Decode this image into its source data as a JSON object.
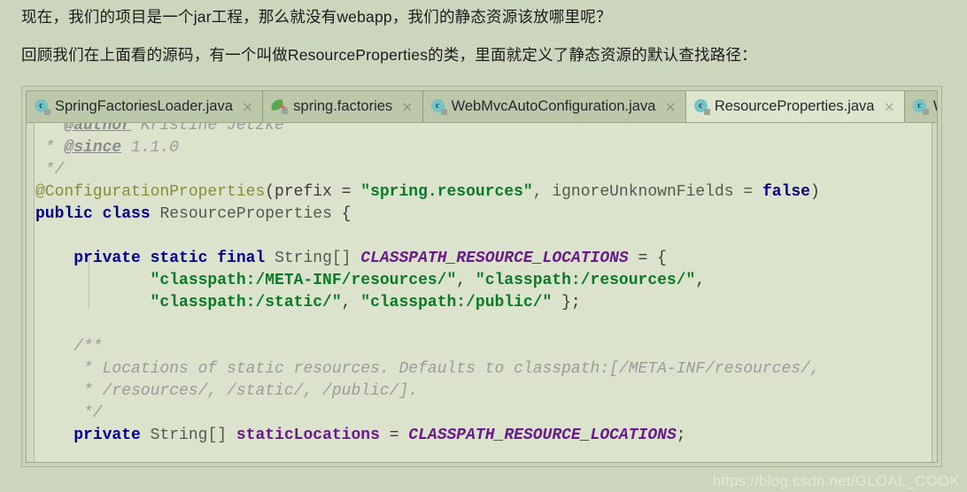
{
  "prose": {
    "paragraph_1": "现在，我们的项目是一个jar工程，那么就没有webapp，我们的静态资源该放哪里呢？",
    "paragraph_2": "回顾我们在上面看的源码，有一个叫做ResourceProperties的类，里面就定义了静态资源的默认查找路径："
  },
  "editor": {
    "tabs": [
      {
        "label": "SpringFactoriesLoader.java",
        "icon": "java-class-icon",
        "close": "×",
        "active": false
      },
      {
        "label": "spring.factories",
        "icon": "spring-leaf-icon",
        "close": "×",
        "active": false
      },
      {
        "label": "WebMvcAutoConfiguration.java",
        "icon": "java-class-icon",
        "close": "×",
        "active": false
      },
      {
        "label": "ResourceProperties.java",
        "icon": "java-class-icon",
        "close": "×",
        "active": true
      },
      {
        "label": "W",
        "icon": "java-class-icon",
        "close": "",
        "active": false
      }
    ],
    "code_lines": [
      {
        "tokens": [
          {
            "t": " * ",
            "c": "cmt"
          },
          {
            "t": "@author",
            "c": "cmt-tag"
          },
          {
            "t": " Kristine Jetzke",
            "c": "cmt"
          }
        ]
      },
      {
        "tokens": [
          {
            "t": " * ",
            "c": "cmt"
          },
          {
            "t": "@since",
            "c": "cmt-tag"
          },
          {
            "t": " 1.1.0",
            "c": "cmt"
          }
        ]
      },
      {
        "tokens": [
          {
            "t": " */",
            "c": "cmt"
          }
        ]
      },
      {
        "tokens": [
          {
            "t": "@ConfigurationProperties",
            "c": "anno"
          },
          {
            "t": "(prefix = ",
            "c": "plain"
          },
          {
            "t": "\"spring.resources\"",
            "c": "str"
          },
          {
            "t": ", ignoreUnknownFields = ",
            "c": "type"
          },
          {
            "t": "false",
            "c": "kw"
          },
          {
            "t": ")",
            "c": "plain"
          }
        ]
      },
      {
        "tokens": [
          {
            "t": "public class ",
            "c": "kw"
          },
          {
            "t": "ResourceProperties ",
            "c": "type"
          },
          {
            "t": "{",
            "c": "plain"
          }
        ]
      },
      {
        "tokens": []
      },
      {
        "tokens": [
          {
            "t": "    ",
            "c": "plain"
          },
          {
            "t": "private static final ",
            "c": "kw"
          },
          {
            "t": "String[] ",
            "c": "type"
          },
          {
            "t": "CLASSPATH_RESOURCE_LOCATIONS",
            "c": "const"
          },
          {
            "t": " = {",
            "c": "plain"
          }
        ]
      },
      {
        "tokens": [
          {
            "t": "            ",
            "c": "plain"
          },
          {
            "t": "\"classpath:/META-INF/resources/\"",
            "c": "str"
          },
          {
            "t": ", ",
            "c": "plain"
          },
          {
            "t": "\"classpath:/resources/\"",
            "c": "str"
          },
          {
            "t": ",",
            "c": "plain"
          }
        ]
      },
      {
        "tokens": [
          {
            "t": "            ",
            "c": "plain"
          },
          {
            "t": "\"classpath:/static/\"",
            "c": "str"
          },
          {
            "t": ", ",
            "c": "plain"
          },
          {
            "t": "\"classpath:/public/\"",
            "c": "str"
          },
          {
            "t": " };",
            "c": "plain"
          }
        ]
      },
      {
        "tokens": []
      },
      {
        "tokens": [
          {
            "t": "    /**",
            "c": "cmt"
          }
        ]
      },
      {
        "tokens": [
          {
            "t": "     * Locations of static resources. Defaults to classpath:[/META-INF/resources/,",
            "c": "cmt"
          }
        ]
      },
      {
        "tokens": [
          {
            "t": "     * /resources/, /static/, /public/].",
            "c": "cmt"
          }
        ]
      },
      {
        "tokens": [
          {
            "t": "     */",
            "c": "cmt"
          }
        ]
      },
      {
        "tokens": [
          {
            "t": "    ",
            "c": "plain"
          },
          {
            "t": "private ",
            "c": "kw"
          },
          {
            "t": "String[] ",
            "c": "type"
          },
          {
            "t": "staticLocations",
            "c": "field"
          },
          {
            "t": " = ",
            "c": "plain"
          },
          {
            "t": "CLASSPATH_RESOURCE_LOCATIONS",
            "c": "const"
          },
          {
            "t": ";",
            "c": "plain"
          }
        ]
      }
    ]
  },
  "watermark": {
    "text": "https://blog.csdn.net/GLOAL_COOK"
  },
  "colors": {
    "page_background": "#ccd6bd",
    "editor_background": "#dbe3cc",
    "tab_inactive": "#bcc8a9",
    "tab_active": "#dde5cd",
    "keyword": "#00008f",
    "string": "#0a7a27",
    "comment": "#9b9b9b",
    "annotation": "#8b8b33",
    "field": "#6a1a8a"
  }
}
